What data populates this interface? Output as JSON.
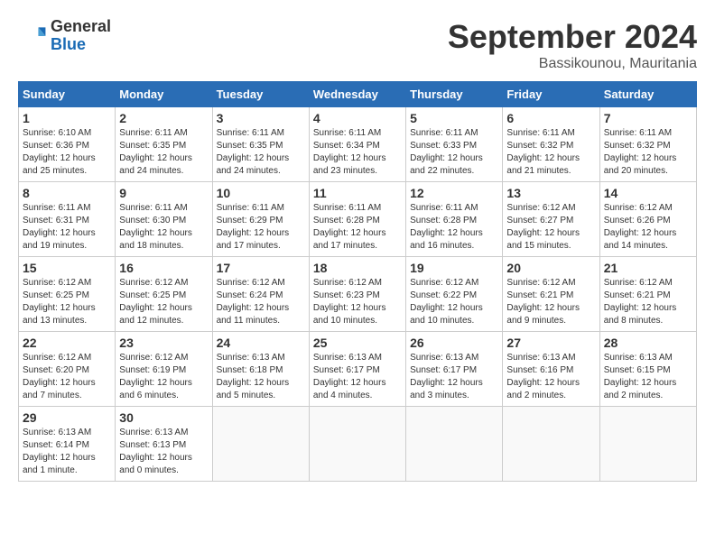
{
  "logo": {
    "general": "General",
    "blue": "Blue"
  },
  "title": "September 2024",
  "location": "Bassikounou, Mauritania",
  "days_of_week": [
    "Sunday",
    "Monday",
    "Tuesday",
    "Wednesday",
    "Thursday",
    "Friday",
    "Saturday"
  ],
  "weeks": [
    [
      {
        "day": "1",
        "sunrise": "6:10 AM",
        "sunset": "6:36 PM",
        "daylight": "12 hours and 25 minutes."
      },
      {
        "day": "2",
        "sunrise": "6:11 AM",
        "sunset": "6:35 PM",
        "daylight": "12 hours and 24 minutes."
      },
      {
        "day": "3",
        "sunrise": "6:11 AM",
        "sunset": "6:35 PM",
        "daylight": "12 hours and 24 minutes."
      },
      {
        "day": "4",
        "sunrise": "6:11 AM",
        "sunset": "6:34 PM",
        "daylight": "12 hours and 23 minutes."
      },
      {
        "day": "5",
        "sunrise": "6:11 AM",
        "sunset": "6:33 PM",
        "daylight": "12 hours and 22 minutes."
      },
      {
        "day": "6",
        "sunrise": "6:11 AM",
        "sunset": "6:32 PM",
        "daylight": "12 hours and 21 minutes."
      },
      {
        "day": "7",
        "sunrise": "6:11 AM",
        "sunset": "6:32 PM",
        "daylight": "12 hours and 20 minutes."
      }
    ],
    [
      {
        "day": "8",
        "sunrise": "6:11 AM",
        "sunset": "6:31 PM",
        "daylight": "12 hours and 19 minutes."
      },
      {
        "day": "9",
        "sunrise": "6:11 AM",
        "sunset": "6:30 PM",
        "daylight": "12 hours and 18 minutes."
      },
      {
        "day": "10",
        "sunrise": "6:11 AM",
        "sunset": "6:29 PM",
        "daylight": "12 hours and 17 minutes."
      },
      {
        "day": "11",
        "sunrise": "6:11 AM",
        "sunset": "6:28 PM",
        "daylight": "12 hours and 17 minutes."
      },
      {
        "day": "12",
        "sunrise": "6:11 AM",
        "sunset": "6:28 PM",
        "daylight": "12 hours and 16 minutes."
      },
      {
        "day": "13",
        "sunrise": "6:12 AM",
        "sunset": "6:27 PM",
        "daylight": "12 hours and 15 minutes."
      },
      {
        "day": "14",
        "sunrise": "6:12 AM",
        "sunset": "6:26 PM",
        "daylight": "12 hours and 14 minutes."
      }
    ],
    [
      {
        "day": "15",
        "sunrise": "6:12 AM",
        "sunset": "6:25 PM",
        "daylight": "12 hours and 13 minutes."
      },
      {
        "day": "16",
        "sunrise": "6:12 AM",
        "sunset": "6:25 PM",
        "daylight": "12 hours and 12 minutes."
      },
      {
        "day": "17",
        "sunrise": "6:12 AM",
        "sunset": "6:24 PM",
        "daylight": "12 hours and 11 minutes."
      },
      {
        "day": "18",
        "sunrise": "6:12 AM",
        "sunset": "6:23 PM",
        "daylight": "12 hours and 10 minutes."
      },
      {
        "day": "19",
        "sunrise": "6:12 AM",
        "sunset": "6:22 PM",
        "daylight": "12 hours and 10 minutes."
      },
      {
        "day": "20",
        "sunrise": "6:12 AM",
        "sunset": "6:21 PM",
        "daylight": "12 hours and 9 minutes."
      },
      {
        "day": "21",
        "sunrise": "6:12 AM",
        "sunset": "6:21 PM",
        "daylight": "12 hours and 8 minutes."
      }
    ],
    [
      {
        "day": "22",
        "sunrise": "6:12 AM",
        "sunset": "6:20 PM",
        "daylight": "12 hours and 7 minutes."
      },
      {
        "day": "23",
        "sunrise": "6:12 AM",
        "sunset": "6:19 PM",
        "daylight": "12 hours and 6 minutes."
      },
      {
        "day": "24",
        "sunrise": "6:13 AM",
        "sunset": "6:18 PM",
        "daylight": "12 hours and 5 minutes."
      },
      {
        "day": "25",
        "sunrise": "6:13 AM",
        "sunset": "6:17 PM",
        "daylight": "12 hours and 4 minutes."
      },
      {
        "day": "26",
        "sunrise": "6:13 AM",
        "sunset": "6:17 PM",
        "daylight": "12 hours and 3 minutes."
      },
      {
        "day": "27",
        "sunrise": "6:13 AM",
        "sunset": "6:16 PM",
        "daylight": "12 hours and 2 minutes."
      },
      {
        "day": "28",
        "sunrise": "6:13 AM",
        "sunset": "6:15 PM",
        "daylight": "12 hours and 2 minutes."
      }
    ],
    [
      {
        "day": "29",
        "sunrise": "6:13 AM",
        "sunset": "6:14 PM",
        "daylight": "12 hours and 1 minute."
      },
      {
        "day": "30",
        "sunrise": "6:13 AM",
        "sunset": "6:13 PM",
        "daylight": "12 hours and 0 minutes."
      },
      null,
      null,
      null,
      null,
      null
    ]
  ]
}
